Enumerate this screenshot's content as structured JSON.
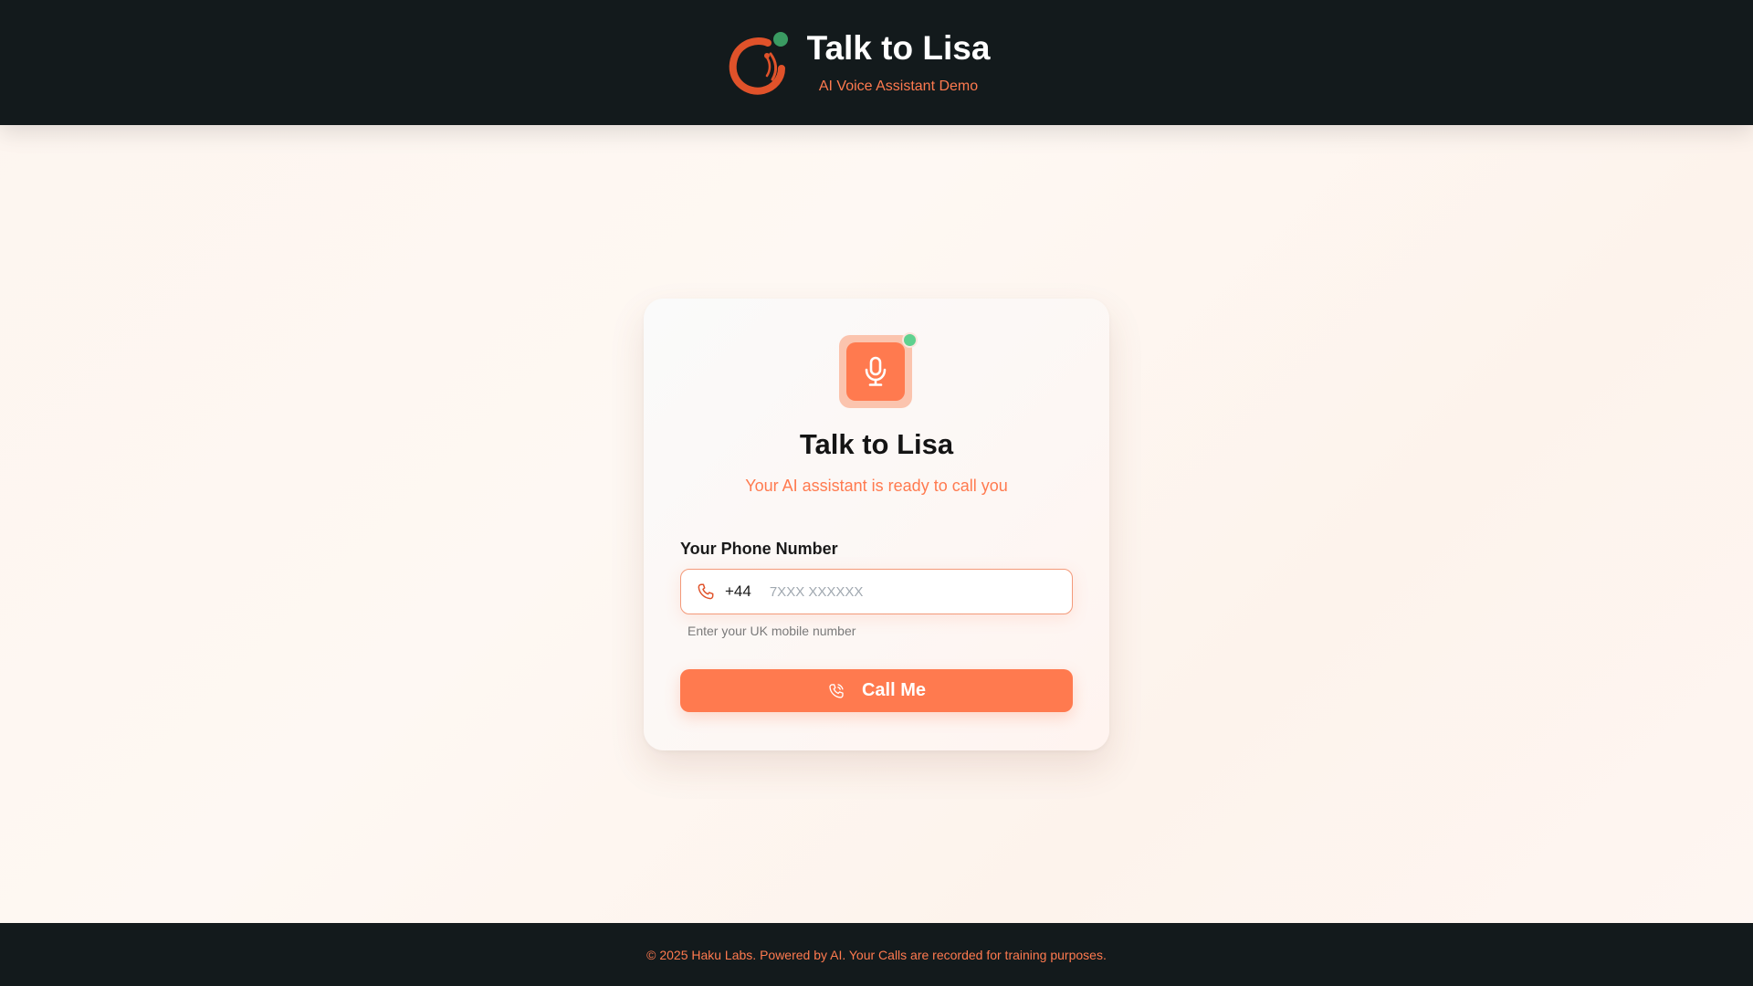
{
  "header": {
    "title": "Talk to Lisa",
    "subtitle": "AI Voice Assistant Demo",
    "logo_icon": "haku-swirl-logo"
  },
  "card": {
    "icon": "microphone-icon",
    "status_indicator": "online",
    "title": "Talk to Lisa",
    "subtitle": "Your AI assistant is ready to call you",
    "phone": {
      "label": "Your Phone Number",
      "prefix": "+44",
      "placeholder": "7XXX XXXXXX",
      "value": "",
      "hint": "Enter your UK mobile number"
    },
    "button": {
      "label": "Call Me",
      "icon": "phone-outgoing-icon"
    }
  },
  "footer": {
    "text": "© 2025 Haku Labs. Powered by AI. Your Calls are recorded for training purposes."
  },
  "colors": {
    "accent": "#ff7a4f",
    "dark": "#131a1c",
    "online": "#5fd18f"
  }
}
